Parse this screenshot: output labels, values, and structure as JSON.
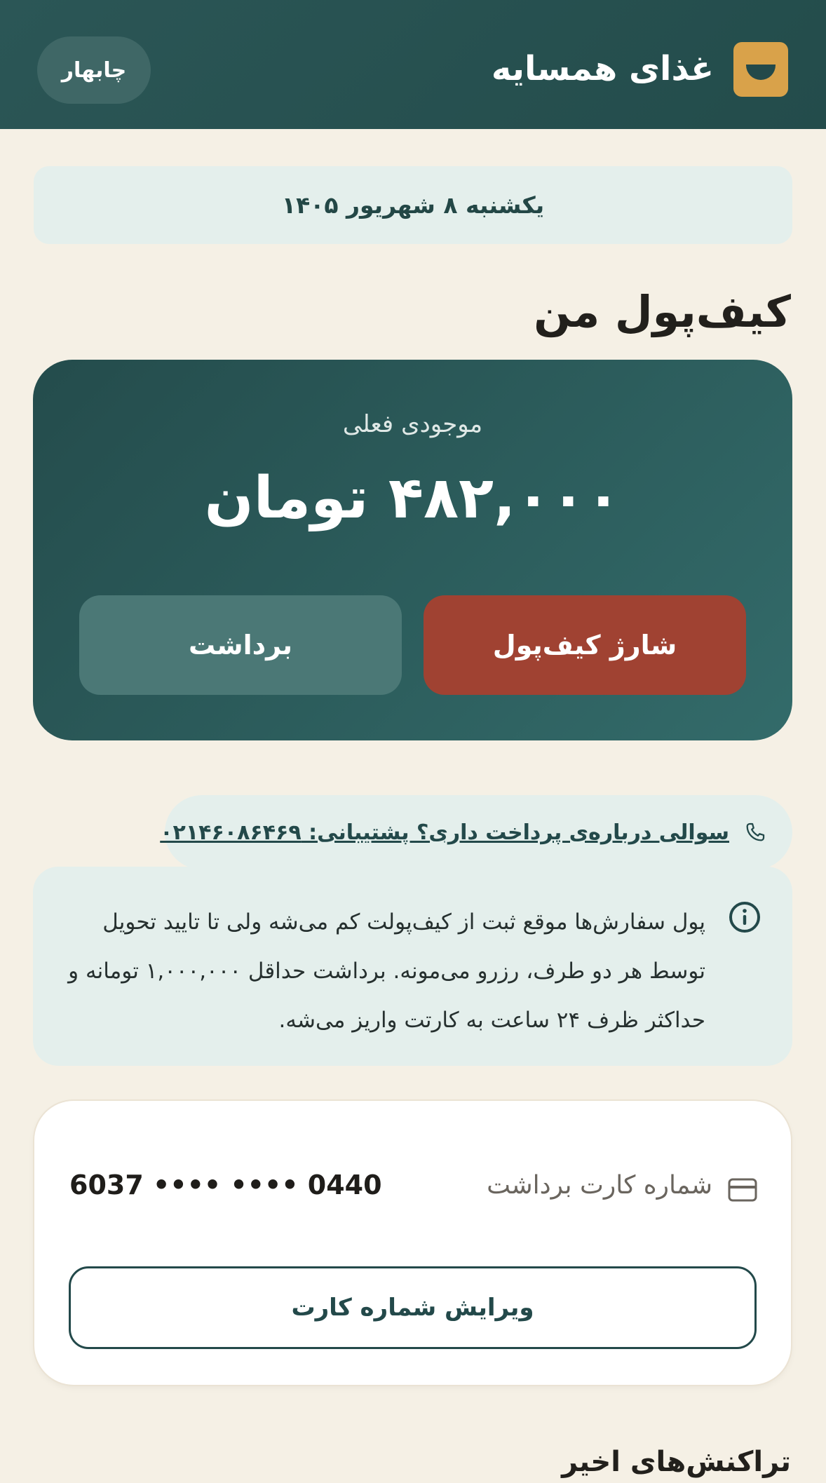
{
  "header": {
    "app_title": "غذای همسایه",
    "city": "چابهار",
    "logo_icon": "bowl-icon"
  },
  "date_banner": "یکشنبه ۸ شهریور ۱۴۰۵",
  "page_title": "کیف‌پول من",
  "wallet": {
    "balance_label": "موجودی فعلی",
    "balance_amount": "۴۸۲,۰۰۰ تومان",
    "charge_label": "شارژ کیف‌پول",
    "withdraw_label": "برداشت"
  },
  "support": {
    "icon": "phone-icon",
    "text": "سوالی درباره‌ی پرداخت داری؟ پشتیبانی: ۰۲۱۴۶۰۸۶۴۶۹"
  },
  "info": {
    "icon": "info-icon",
    "text": "پول سفارش‌ها موقع ثبت از کیف‌پولت کم می‌شه ولی تا تایید تحویل توسط هر دو طرف، رزرو می‌مونه. برداشت حداقل ۱,۰۰۰,۰۰۰ تومانه و حداکثر ظرف ۲۴ ساعت به کارتت واریز می‌شه."
  },
  "card": {
    "icon": "credit-card-icon",
    "label": "شماره کارت برداشت",
    "number": "6037 •••• •••• 0440",
    "edit_label": "ویرایش شماره کارت"
  },
  "transactions": {
    "title": "تراکنش‌های اخیر"
  },
  "colors": {
    "header": "#244d4c",
    "accent_red": "#a04232",
    "logo_gold": "#d9a24a",
    "background": "#f5f0e5"
  }
}
